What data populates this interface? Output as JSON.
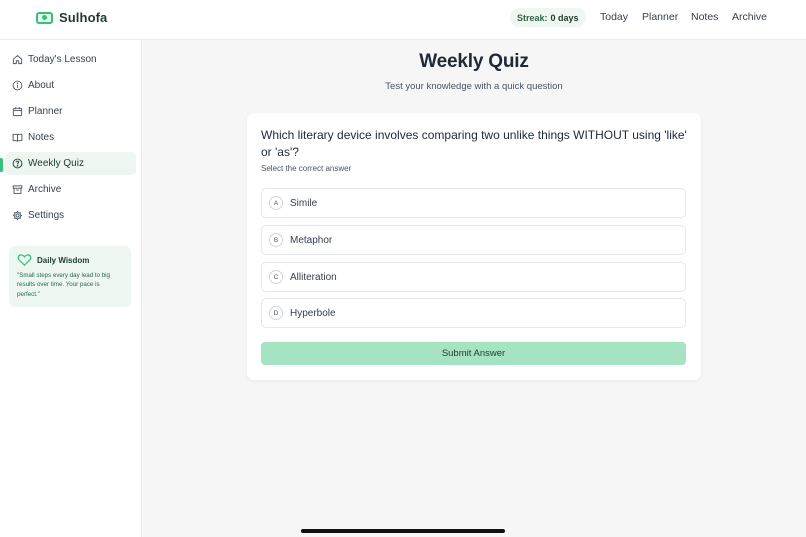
{
  "app": {
    "name": "Sulhofa",
    "streak_label": "Streak:",
    "streak_value": "0 days"
  },
  "topnav": [
    {
      "label": "Today"
    },
    {
      "label": "Planner"
    },
    {
      "label": "Notes"
    },
    {
      "label": "Archive"
    }
  ],
  "sidebar": {
    "items": [
      {
        "label": "Today's Lesson",
        "icon": "home-icon"
      },
      {
        "label": "About",
        "icon": "info-icon"
      },
      {
        "label": "Planner",
        "icon": "calendar-icon"
      },
      {
        "label": "Notes",
        "icon": "book-icon"
      },
      {
        "label": "Weekly Quiz",
        "icon": "question-icon",
        "active": true
      },
      {
        "label": "Archive",
        "icon": "archive-icon"
      },
      {
        "label": "Settings",
        "icon": "gear-icon"
      }
    ],
    "wisdom": {
      "title": "Daily Wisdom",
      "icon": "heart-icon",
      "text": "\"Small steps every day lead to big results over time. Your pace is perfect.\""
    }
  },
  "main": {
    "title": "Weekly Quiz",
    "subtitle": "Test your knowledge with a quick question",
    "quiz": {
      "question": "Which literary device involves comparing two unlike things WITHOUT using 'like' or 'as'?",
      "instruction": "Select the correct answer",
      "options": [
        {
          "letter": "A",
          "text": "Simile"
        },
        {
          "letter": "B",
          "text": "Metaphor"
        },
        {
          "letter": "C",
          "text": "Alliteration"
        },
        {
          "letter": "D",
          "text": "Hyperbole"
        }
      ],
      "submit_label": "Submit Answer"
    }
  },
  "colors": {
    "accent": "#34c27a",
    "submit_bg": "#a5e3c3",
    "active_bg": "#eef6f1",
    "main_bg": "#f5f6f5"
  }
}
